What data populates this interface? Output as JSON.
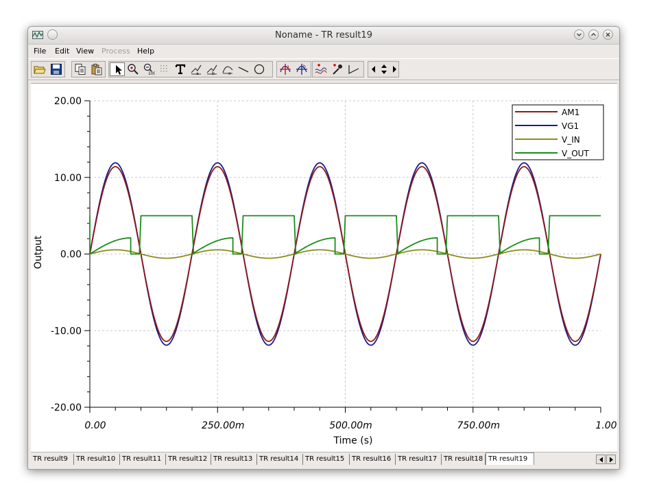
{
  "window": {
    "title": "Noname - TR result19"
  },
  "menu": {
    "items": [
      {
        "label": "File",
        "enabled": true
      },
      {
        "label": "Edit",
        "enabled": true
      },
      {
        "label": "View",
        "enabled": true
      },
      {
        "label": "Process",
        "enabled": false
      },
      {
        "label": "Help",
        "enabled": true
      }
    ]
  },
  "toolbar": {
    "icons": [
      "open-folder-icon",
      "save-icon",
      "copy-icon",
      "paste-icon",
      "select-arrow-icon",
      "zoom-in-icon",
      "zoom-100-icon",
      "grid-icon",
      "text-icon",
      "cursor-a-icon",
      "cursor-b-icon",
      "axis-icon",
      "line-icon",
      "circle-icon",
      "marker-a-icon",
      "marker-b-icon",
      "add-curve-icon",
      "pick-color-icon",
      "tangent-icon",
      "scroll-left-icon",
      "scroll-up-down-icon",
      "scroll-right-icon"
    ]
  },
  "tabs": {
    "items": [
      "TR result9",
      "TR result10",
      "TR result11",
      "TR result12",
      "TR result13",
      "TR result14",
      "TR result15",
      "TR result16",
      "TR result17",
      "TR result18",
      "TR result19"
    ],
    "active_index": 10
  },
  "chart_data": {
    "type": "line",
    "xlabel": "Time (s)",
    "ylabel": "Output",
    "xlim": [
      0,
      1.0
    ],
    "ylim": [
      -20,
      20
    ],
    "x_ticks": [
      0,
      0.25,
      0.5,
      0.75,
      1.0
    ],
    "x_tick_labels": [
      "0.00",
      "250.00m",
      "500.00m",
      "750.00m",
      "1.00"
    ],
    "y_ticks": [
      20,
      10,
      0,
      -10,
      -20
    ],
    "y_tick_labels": [
      "20.00",
      "10.00",
      "0.00",
      "-10.00",
      "-20.00"
    ],
    "grid": true,
    "legend_position": "top-right",
    "series": [
      {
        "name": "AM1",
        "color": "#8b1a1a",
        "shape": "sine",
        "amplitude": 11.4,
        "frequency_hz": 5,
        "phase": 0
      },
      {
        "name": "VG1",
        "color": "#1a1a8c",
        "shape": "sine",
        "amplitude": 11.9,
        "frequency_hz": 5,
        "phase": 0
      },
      {
        "name": "V_IN",
        "color": "#8c8c1a",
        "shape": "sine",
        "amplitude": 0.55,
        "frequency_hz": 5,
        "phase": 0
      },
      {
        "name": "V_OUT",
        "color": "#1a8c1a",
        "shape": "pulse",
        "high": 5.0,
        "ramp_peak": 2.1,
        "events": [
          {
            "t_start": 0.0,
            "t_end": 0.0,
            "kind": "spike"
          },
          {
            "t_start": 0.0,
            "t_ramp_end": 0.08,
            "t_high_start": 0.1,
            "t_high_end": 0.2
          },
          {
            "t_start": 0.2,
            "t_ramp_end": 0.28,
            "t_high_start": 0.3,
            "t_high_end": 0.4
          },
          {
            "t_start": 0.4,
            "t_ramp_end": 0.48,
            "t_high_start": 0.5,
            "t_high_end": 0.6
          },
          {
            "t_start": 0.6,
            "t_ramp_end": 0.68,
            "t_high_start": 0.7,
            "t_high_end": 0.8
          },
          {
            "t_start": 0.8,
            "t_ramp_end": 0.88,
            "t_high_start": 0.9,
            "t_high_end": 1.0
          }
        ]
      }
    ]
  }
}
